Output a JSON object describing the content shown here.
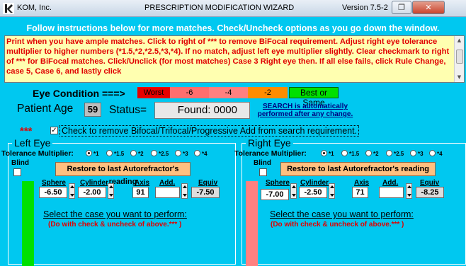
{
  "window": {
    "app_name": "KOM, Inc.",
    "title": "PRESCRIPTION MODIFICATION WIZARD",
    "version": "Version 7.5-2",
    "restore_glyph": "❐",
    "close_glyph": "✕"
  },
  "instructions": {
    "header": "Follow instructions below for more matches. Check/Uncheck options as you go down the window.",
    "text": "Print when you have ample matches. Click to right of *** to remove BiFocal requirement. Adjust right eye tolerance multiplier to higher numbers (*1.5,*2,*2.5,*3,*4). If no match, adjust left eye multiplier slightly. Clear checkmark to right of *** for BiFocal matches. Click/Unclick (for most matches) Case 3 Right eye then. If all else fails, click Rule Change, case 5, Case 6, and lastly click"
  },
  "eye_condition": {
    "label": "Eye Condition ===>",
    "levels": [
      "Worst",
      "-6",
      "-4",
      "-2",
      "Best or Same"
    ]
  },
  "patient": {
    "age_label": "Patient Age",
    "age": "59",
    "status_label": "Status=",
    "status": "Found: 0000",
    "search_note": "SEARCH is automatically performed after any change."
  },
  "bifocal": {
    "stars": "***",
    "checked": true,
    "label": "Check to remove Bifocal/Trifocal/Progressive Add from search requirement."
  },
  "tolerance": {
    "label": "Tolerance Multiplier:",
    "options": [
      "*1",
      "*1.5",
      "*2",
      "*2.5",
      "*3",
      "*4"
    ]
  },
  "field_labels": {
    "blind": "Blind",
    "restore": "Restore to last Autorefractor's reading",
    "sphere": "Sphere",
    "cylinder": "Cylinder",
    "axis": "Axis",
    "add": "Add.",
    "equiv": "Equiv",
    "case_title": "Select the case you want to perform:",
    "case_note": "(Do with check & uncheck of above.*** )"
  },
  "left_eye": {
    "title": "Left Eye",
    "selected_tolerance": "*1",
    "sphere": "-6.50",
    "cylinder": "-2.00",
    "axis": "91",
    "add": "",
    "equiv": "-7.50",
    "bar_color": "#00e000"
  },
  "right_eye": {
    "title": "Right Eye",
    "selected_tolerance": "*1",
    "sphere": "-7.00",
    "cylinder": "-2.50",
    "axis": "71",
    "add": "",
    "equiv": "-8.25",
    "bar_color": "#ff8080"
  },
  "colors": {
    "background": "#00c8f0",
    "instruction_bg": "#ffffb0",
    "instruction_text": "#e00000",
    "worst": "#e60000",
    "best": "#00e000",
    "restore_button": "#ffc080"
  }
}
